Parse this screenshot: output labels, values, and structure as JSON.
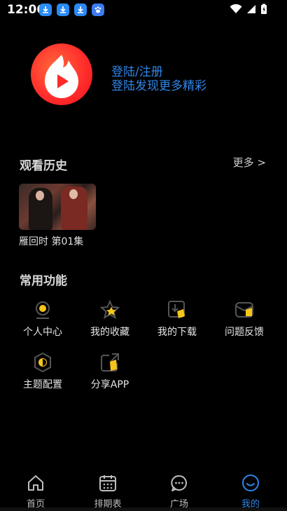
{
  "status_bar": {
    "time": "12:06"
  },
  "profile": {
    "login_title": "登陆/注册",
    "login_subtitle": "登陆发现更多精彩"
  },
  "history": {
    "title": "观看历史",
    "more_label": "更多 >",
    "items": [
      {
        "caption": "雁回时 第01集"
      }
    ]
  },
  "functions": {
    "title": "常用功能",
    "items": [
      {
        "label": "个人中心",
        "icon": "person-center-icon"
      },
      {
        "label": "我的收藏",
        "icon": "star-icon"
      },
      {
        "label": "我的下载",
        "icon": "download-icon"
      },
      {
        "label": "问题反馈",
        "icon": "feedback-icon"
      },
      {
        "label": "主题配置",
        "icon": "theme-icon"
      },
      {
        "label": "分享APP",
        "icon": "share-icon"
      }
    ]
  },
  "bottom_nav": {
    "items": [
      {
        "label": "首页",
        "icon": "home-icon"
      },
      {
        "label": "排期表",
        "icon": "calendar-icon"
      },
      {
        "label": "广场",
        "icon": "chat-icon"
      },
      {
        "label": "我的",
        "icon": "profile-icon",
        "active": true
      }
    ]
  },
  "colors": {
    "accent": "#2f86e8",
    "icon_highlight": "#f5c518",
    "background": "#000000"
  }
}
